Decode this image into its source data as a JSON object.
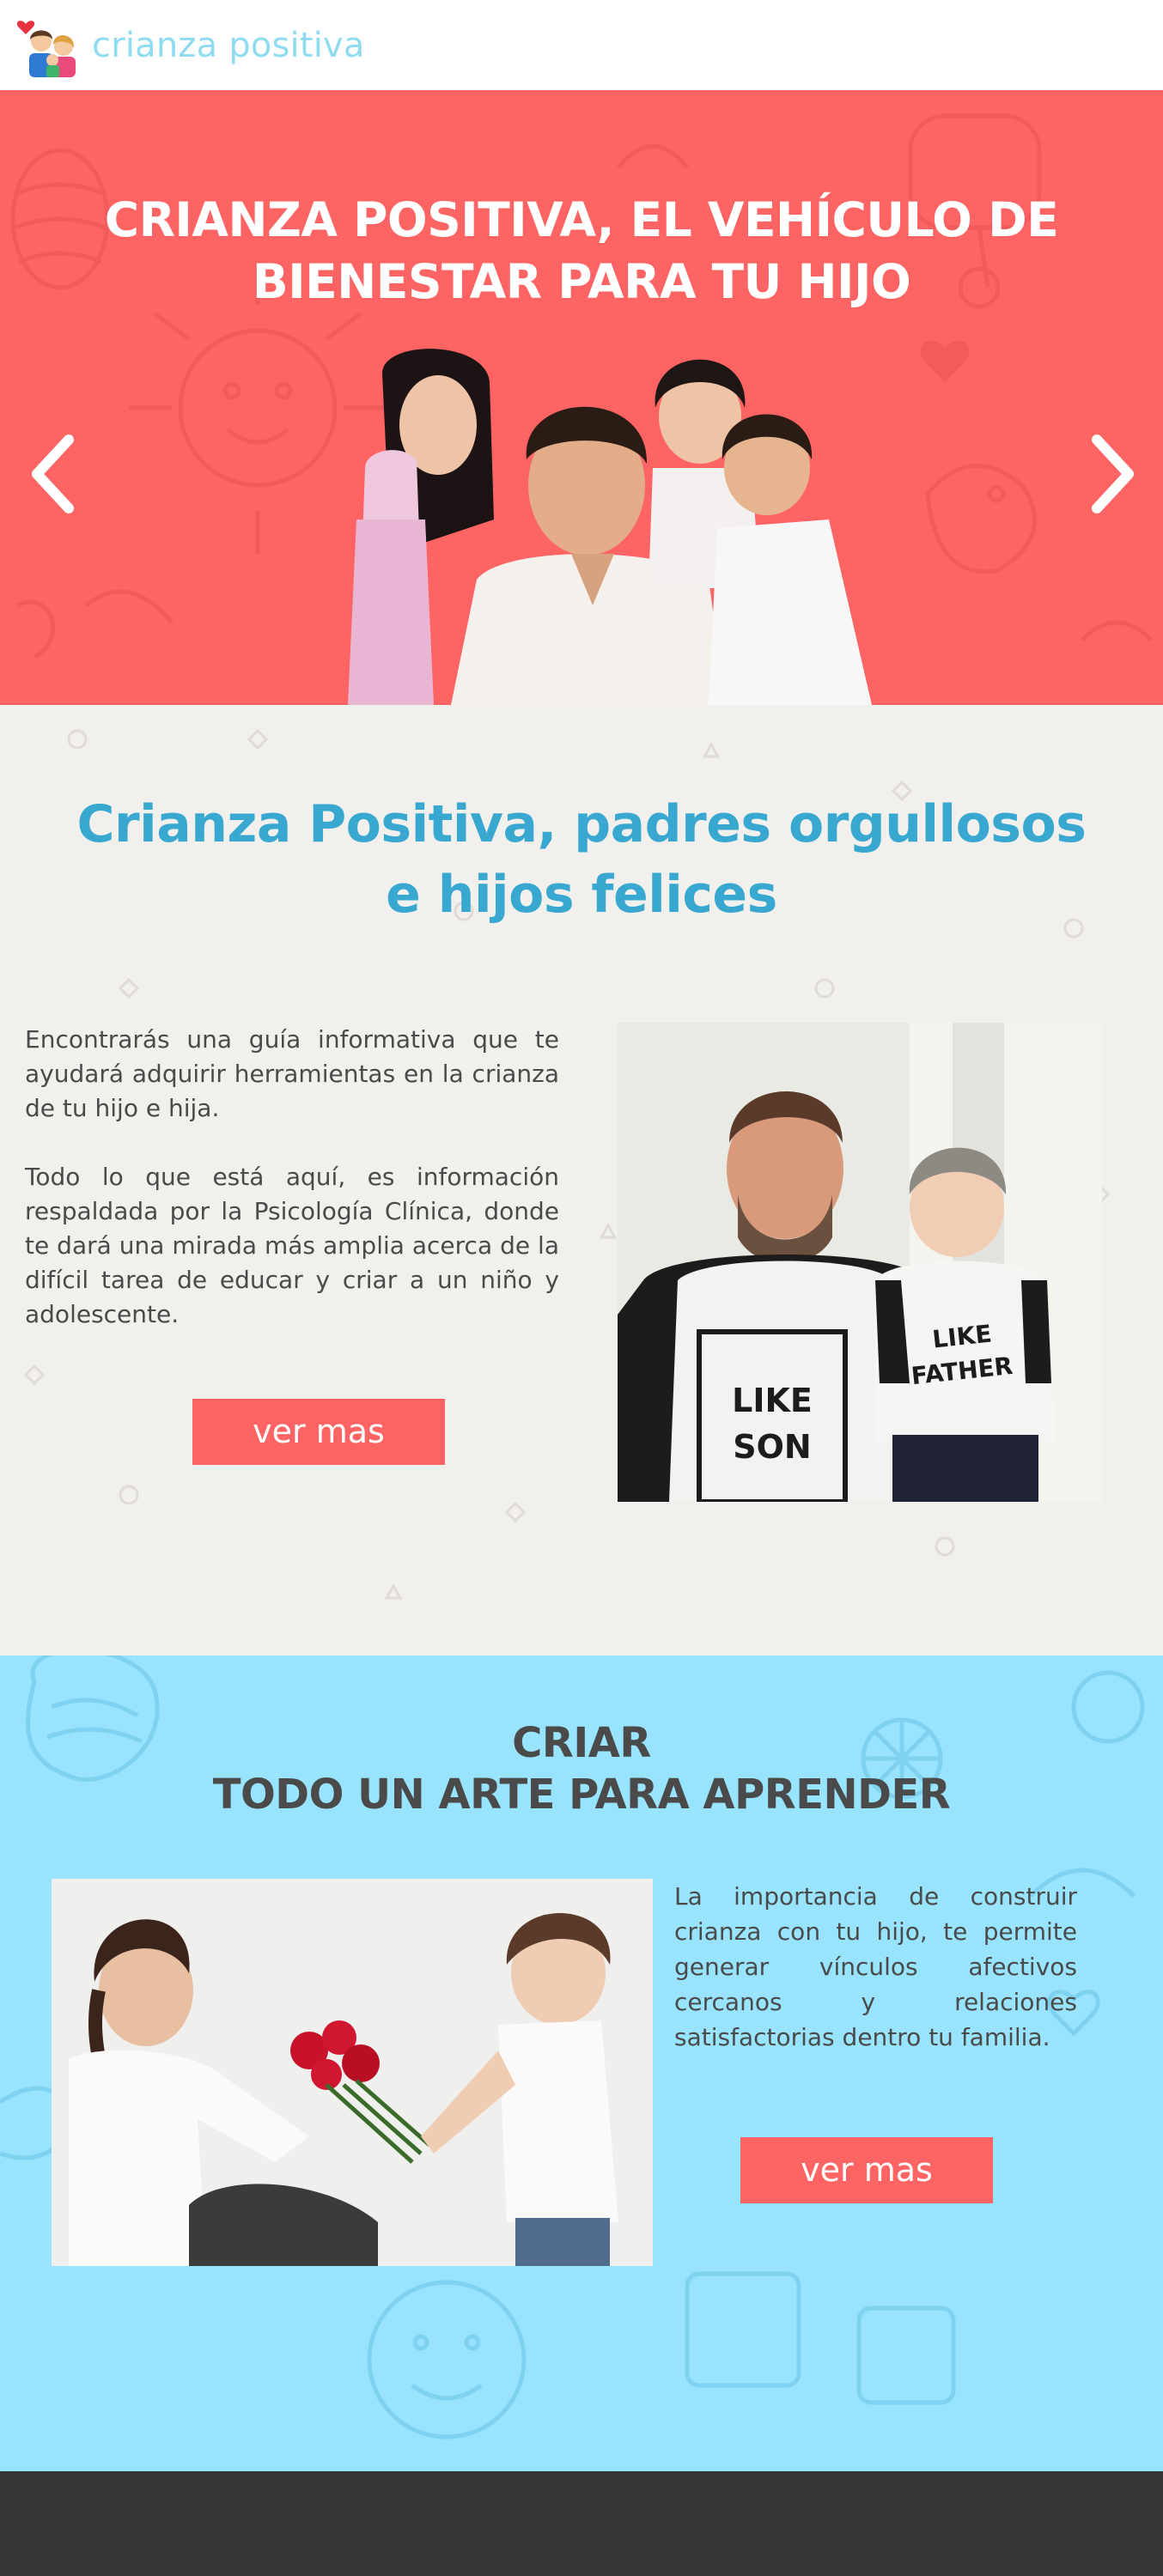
{
  "header": {
    "brand": "crianza positiva",
    "logo_icon": "family-with-heart-icon"
  },
  "hero": {
    "title_line1": "CRIANZA POSITIVA, EL VEHÍCULO DE",
    "title_line2": "BIENESTAR  PARA TU HIJO",
    "prev_icon": "chevron-left-icon",
    "next_icon": "chevron-right-icon",
    "background_color": "#fe6464"
  },
  "intro": {
    "title_line1": "Crianza Positiva, padres orgullosos",
    "title_line2": "e hijos felices",
    "paragraph1": "Encontrarás una guía informativa que te ayudará adquirir herramientas en la crianza de tu hijo e hija.",
    "paragraph2": "Todo lo que está aquí, es información respaldada por la Psicología Clínica, donde te dará una mirada más amplia acerca de la difícil tarea de educar y criar a un niño y adolescente.",
    "button_label": "ver mas",
    "shirt_left_line1": "LIKE",
    "shirt_left_line2": "SON",
    "shirt_right_line1": "LIKE",
    "shirt_right_line2": "FATHER",
    "title_color": "#39a8d0"
  },
  "art": {
    "title_line1": "CRIAR",
    "title_line2": "TODO UN ARTE PARA APRENDER",
    "paragraph": "La importancia de construir crianza con tu hijo, te permite generar vínculos afectivos cercanos y relaciones satisfactorias dentro tu familia.",
    "button_label": "ver mas",
    "background_color": "#98e3fd"
  },
  "colors": {
    "accent": "#fe6464",
    "brand": "#8fdcf2",
    "footer": "#363636"
  }
}
